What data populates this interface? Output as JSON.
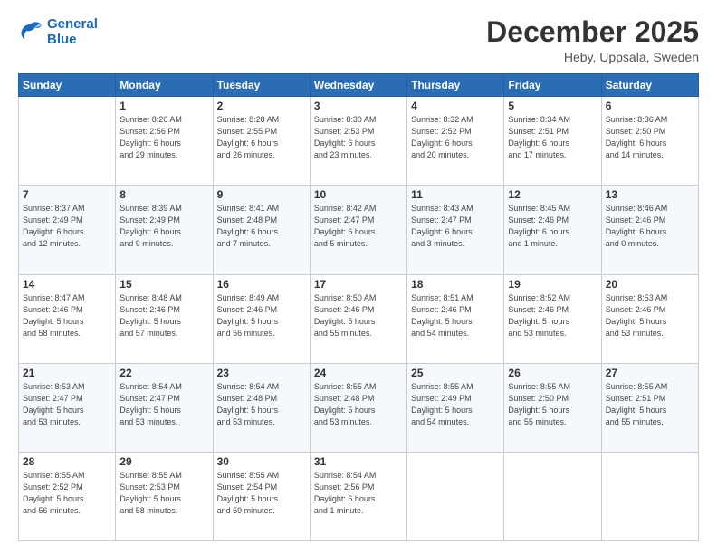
{
  "logo": {
    "line1": "General",
    "line2": "Blue"
  },
  "title": "December 2025",
  "subtitle": "Heby, Uppsala, Sweden",
  "days_header": [
    "Sunday",
    "Monday",
    "Tuesday",
    "Wednesday",
    "Thursday",
    "Friday",
    "Saturday"
  ],
  "weeks": [
    [
      {
        "day": "",
        "info": ""
      },
      {
        "day": "1",
        "info": "Sunrise: 8:26 AM\nSunset: 2:56 PM\nDaylight: 6 hours\nand 29 minutes."
      },
      {
        "day": "2",
        "info": "Sunrise: 8:28 AM\nSunset: 2:55 PM\nDaylight: 6 hours\nand 26 minutes."
      },
      {
        "day": "3",
        "info": "Sunrise: 8:30 AM\nSunset: 2:53 PM\nDaylight: 6 hours\nand 23 minutes."
      },
      {
        "day": "4",
        "info": "Sunrise: 8:32 AM\nSunset: 2:52 PM\nDaylight: 6 hours\nand 20 minutes."
      },
      {
        "day": "5",
        "info": "Sunrise: 8:34 AM\nSunset: 2:51 PM\nDaylight: 6 hours\nand 17 minutes."
      },
      {
        "day": "6",
        "info": "Sunrise: 8:36 AM\nSunset: 2:50 PM\nDaylight: 6 hours\nand 14 minutes."
      }
    ],
    [
      {
        "day": "7",
        "info": "Sunrise: 8:37 AM\nSunset: 2:49 PM\nDaylight: 6 hours\nand 12 minutes."
      },
      {
        "day": "8",
        "info": "Sunrise: 8:39 AM\nSunset: 2:49 PM\nDaylight: 6 hours\nand 9 minutes."
      },
      {
        "day": "9",
        "info": "Sunrise: 8:41 AM\nSunset: 2:48 PM\nDaylight: 6 hours\nand 7 minutes."
      },
      {
        "day": "10",
        "info": "Sunrise: 8:42 AM\nSunset: 2:47 PM\nDaylight: 6 hours\nand 5 minutes."
      },
      {
        "day": "11",
        "info": "Sunrise: 8:43 AM\nSunset: 2:47 PM\nDaylight: 6 hours\nand 3 minutes."
      },
      {
        "day": "12",
        "info": "Sunrise: 8:45 AM\nSunset: 2:46 PM\nDaylight: 6 hours\nand 1 minute."
      },
      {
        "day": "13",
        "info": "Sunrise: 8:46 AM\nSunset: 2:46 PM\nDaylight: 6 hours\nand 0 minutes."
      }
    ],
    [
      {
        "day": "14",
        "info": "Sunrise: 8:47 AM\nSunset: 2:46 PM\nDaylight: 5 hours\nand 58 minutes."
      },
      {
        "day": "15",
        "info": "Sunrise: 8:48 AM\nSunset: 2:46 PM\nDaylight: 5 hours\nand 57 minutes."
      },
      {
        "day": "16",
        "info": "Sunrise: 8:49 AM\nSunset: 2:46 PM\nDaylight: 5 hours\nand 56 minutes."
      },
      {
        "day": "17",
        "info": "Sunrise: 8:50 AM\nSunset: 2:46 PM\nDaylight: 5 hours\nand 55 minutes."
      },
      {
        "day": "18",
        "info": "Sunrise: 8:51 AM\nSunset: 2:46 PM\nDaylight: 5 hours\nand 54 minutes."
      },
      {
        "day": "19",
        "info": "Sunrise: 8:52 AM\nSunset: 2:46 PM\nDaylight: 5 hours\nand 53 minutes."
      },
      {
        "day": "20",
        "info": "Sunrise: 8:53 AM\nSunset: 2:46 PM\nDaylight: 5 hours\nand 53 minutes."
      }
    ],
    [
      {
        "day": "21",
        "info": "Sunrise: 8:53 AM\nSunset: 2:47 PM\nDaylight: 5 hours\nand 53 minutes."
      },
      {
        "day": "22",
        "info": "Sunrise: 8:54 AM\nSunset: 2:47 PM\nDaylight: 5 hours\nand 53 minutes."
      },
      {
        "day": "23",
        "info": "Sunrise: 8:54 AM\nSunset: 2:48 PM\nDaylight: 5 hours\nand 53 minutes."
      },
      {
        "day": "24",
        "info": "Sunrise: 8:55 AM\nSunset: 2:48 PM\nDaylight: 5 hours\nand 53 minutes."
      },
      {
        "day": "25",
        "info": "Sunrise: 8:55 AM\nSunset: 2:49 PM\nDaylight: 5 hours\nand 54 minutes."
      },
      {
        "day": "26",
        "info": "Sunrise: 8:55 AM\nSunset: 2:50 PM\nDaylight: 5 hours\nand 55 minutes."
      },
      {
        "day": "27",
        "info": "Sunrise: 8:55 AM\nSunset: 2:51 PM\nDaylight: 5 hours\nand 55 minutes."
      }
    ],
    [
      {
        "day": "28",
        "info": "Sunrise: 8:55 AM\nSunset: 2:52 PM\nDaylight: 5 hours\nand 56 minutes."
      },
      {
        "day": "29",
        "info": "Sunrise: 8:55 AM\nSunset: 2:53 PM\nDaylight: 5 hours\nand 58 minutes."
      },
      {
        "day": "30",
        "info": "Sunrise: 8:55 AM\nSunset: 2:54 PM\nDaylight: 5 hours\nand 59 minutes."
      },
      {
        "day": "31",
        "info": "Sunrise: 8:54 AM\nSunset: 2:56 PM\nDaylight: 6 hours\nand 1 minute."
      },
      {
        "day": "",
        "info": ""
      },
      {
        "day": "",
        "info": ""
      },
      {
        "day": "",
        "info": ""
      }
    ]
  ]
}
